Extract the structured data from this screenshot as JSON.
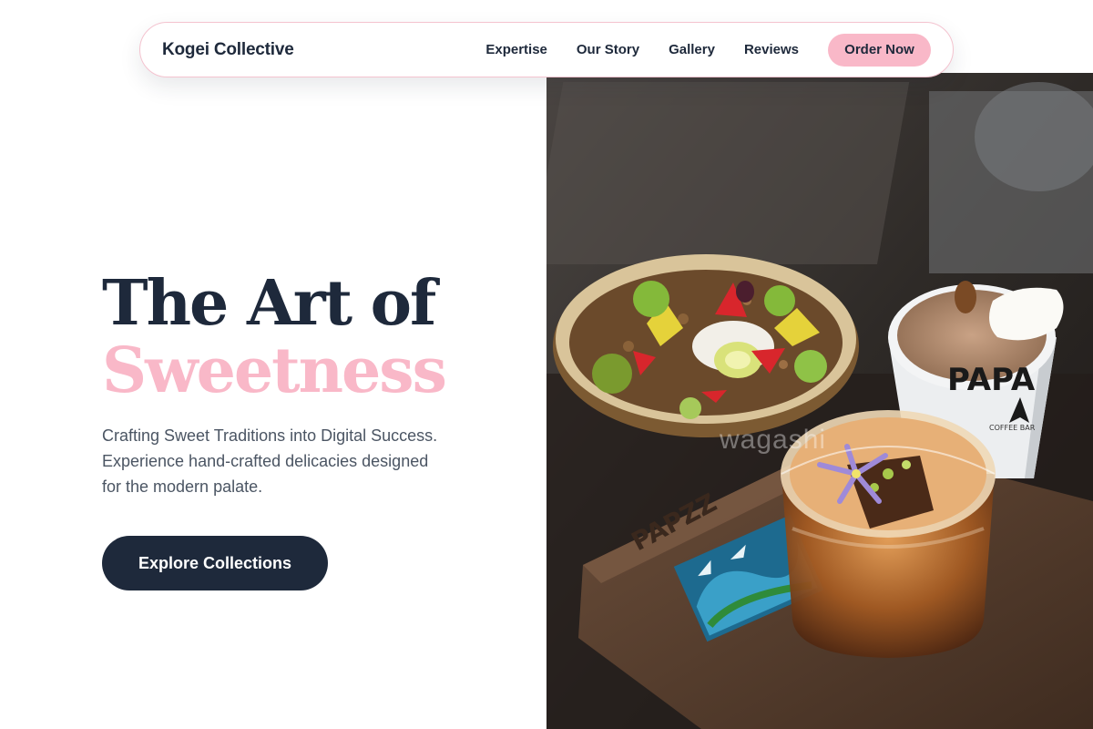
{
  "nav": {
    "brand": "Kogei Collective",
    "links": [
      "Expertise",
      "Our Story",
      "Gallery",
      "Reviews"
    ],
    "cta_label": "Order Now"
  },
  "hero": {
    "title_line1": "The Art of",
    "title_line2": "Sweetness",
    "subtitle": "Crafting Sweet Traditions into Digital Success. Experience hand-crafted delicacies designed for the modern palate.",
    "cta_label": "Explore Collections",
    "cup_text": "PAPA",
    "cup_subtext": "COFFEE BAR",
    "tray_text": "PAPZZ",
    "watermark": "wagashi"
  },
  "colors": {
    "navy": "#1e293b",
    "pink": "#f9b8c8",
    "muted_text": "#4b5563"
  }
}
